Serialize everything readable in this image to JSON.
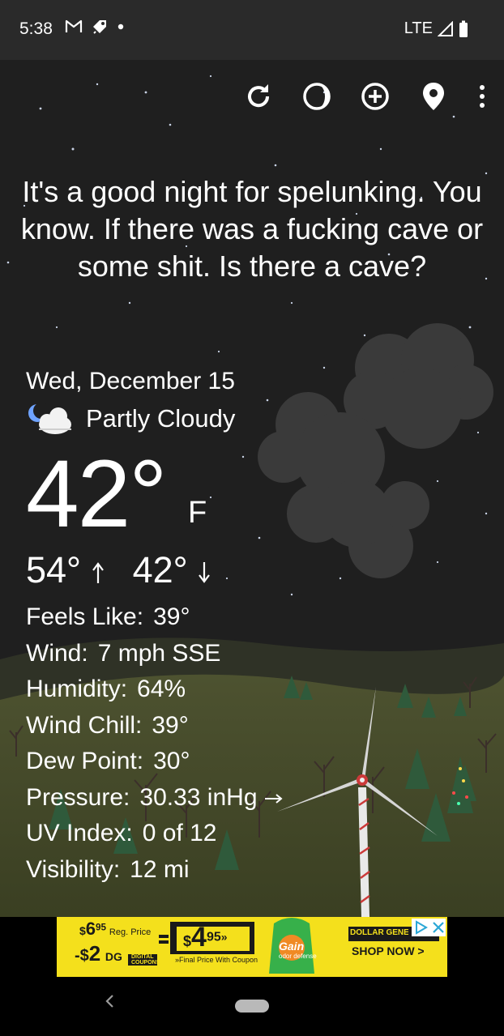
{
  "status_bar": {
    "time": "5:38",
    "network": "LTE"
  },
  "toolbar": {
    "icons": [
      "refresh-icon",
      "theme-toggle-icon",
      "add-location-icon",
      "location-pin-icon",
      "more-vert-icon"
    ]
  },
  "quote": "It's a good night for spelunking. You know. If there was a fucking cave or some shit. Is there a cave?",
  "weather": {
    "date": "Wed, December 15",
    "condition": "Partly Cloudy",
    "temperature": "42°",
    "unit": "F",
    "high": "54°",
    "low": "42°",
    "details": [
      {
        "label": "Feels Like:",
        "value": "39°"
      },
      {
        "label": "Wind:",
        "value": "7 mph SSE"
      },
      {
        "label": "Humidity:",
        "value": "64%"
      },
      {
        "label": "Wind Chill:",
        "value": "39°"
      },
      {
        "label": "Dew Point:",
        "value": "30°"
      },
      {
        "label": "Pressure:",
        "value": "30.33 inHg"
      },
      {
        "label": "UV Index:",
        "value": "0 of 12"
      },
      {
        "label": "Visibility:",
        "value": "12 mi"
      }
    ]
  },
  "ad": {
    "price_sup": "$",
    "price_whole": "6",
    "price_cents": "95",
    "reg_price_label": "Reg. Price",
    "minus": "-$",
    "discount": "2",
    "dg": "DG",
    "digital_line1": "DIGITAL",
    "digital_line2": "COUPONS",
    "final_dollar": "$",
    "final_whole": "4",
    "final_cents": "95",
    "final_quote": "»",
    "final_label": "»Final Price With Coupon",
    "product": "Gain",
    "product_sub": "odor defense",
    "brand": "DOLLAR GENERAL",
    "cta": "SHOP NOW >"
  }
}
